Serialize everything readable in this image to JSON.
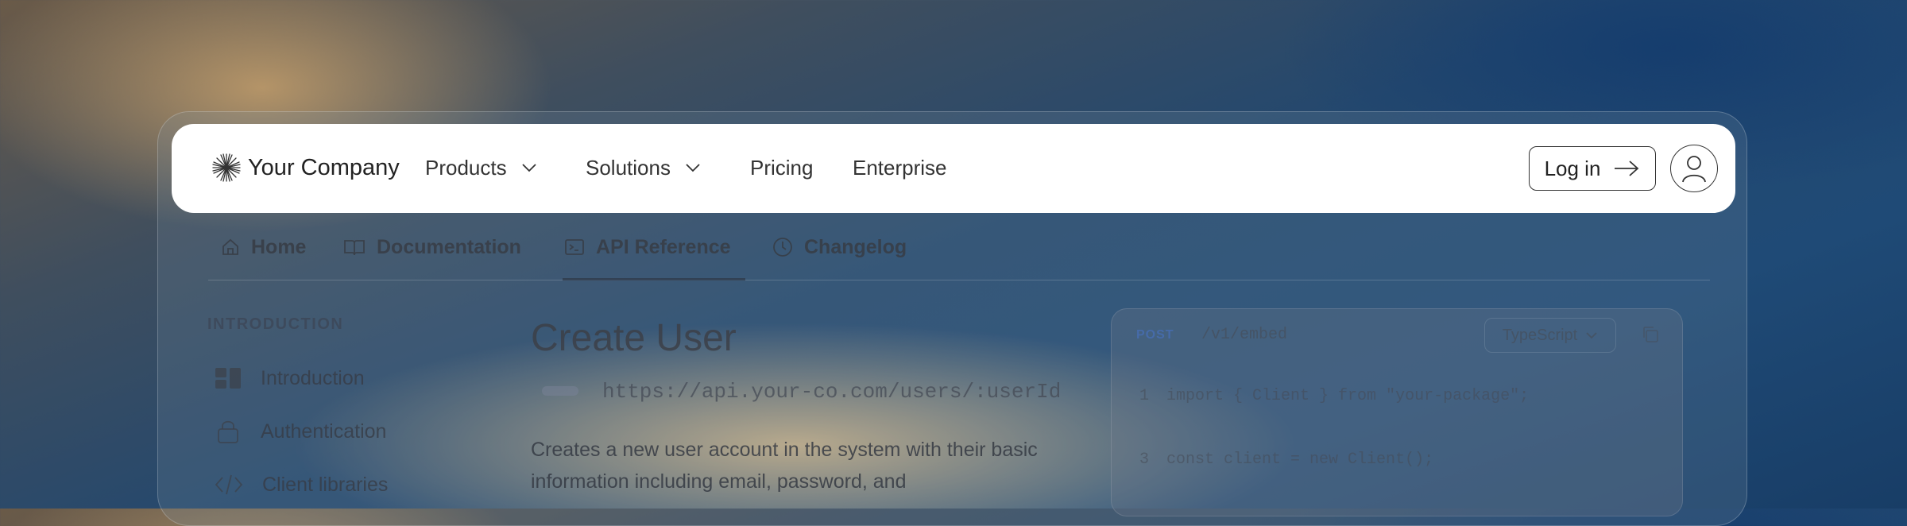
{
  "header": {
    "company_name": "Your Company",
    "nav": [
      {
        "label": "Products",
        "has_dropdown": true
      },
      {
        "label": "Solutions",
        "has_dropdown": true
      },
      {
        "label": "Pricing",
        "has_dropdown": false
      },
      {
        "label": "Enterprise",
        "has_dropdown": false
      }
    ],
    "login_label": "Log in"
  },
  "tabs": [
    {
      "label": "Home",
      "icon": "home-icon"
    },
    {
      "label": "Documentation",
      "icon": "book-icon"
    },
    {
      "label": "API Reference",
      "icon": "terminal-icon",
      "active": true
    },
    {
      "label": "Changelog",
      "icon": "clock-icon"
    }
  ],
  "sidebar": {
    "heading": "INTRODUCTION",
    "items": [
      {
        "label": "Introduction",
        "icon": "grid-icon"
      },
      {
        "label": "Authentication",
        "icon": "lock-icon"
      },
      {
        "label": "Client libraries",
        "icon": "code-icon"
      }
    ]
  },
  "main": {
    "title": "Create User",
    "endpoint": "https://api.your-co.com/users/:userId",
    "description": "Creates a new user account in the system with their basic information including email, password, and"
  },
  "code_panel": {
    "method": "POST",
    "path": "/v1/embed",
    "language": "TypeScript",
    "lines": [
      {
        "number": "1",
        "code": "import { Client } from \"your-package\";"
      },
      {
        "number": "3",
        "code": "const client = new Client();"
      }
    ]
  },
  "colors": {
    "navbar_bg": "#ffffff",
    "text_dark": "#222222",
    "code_method": "#466eb4"
  }
}
